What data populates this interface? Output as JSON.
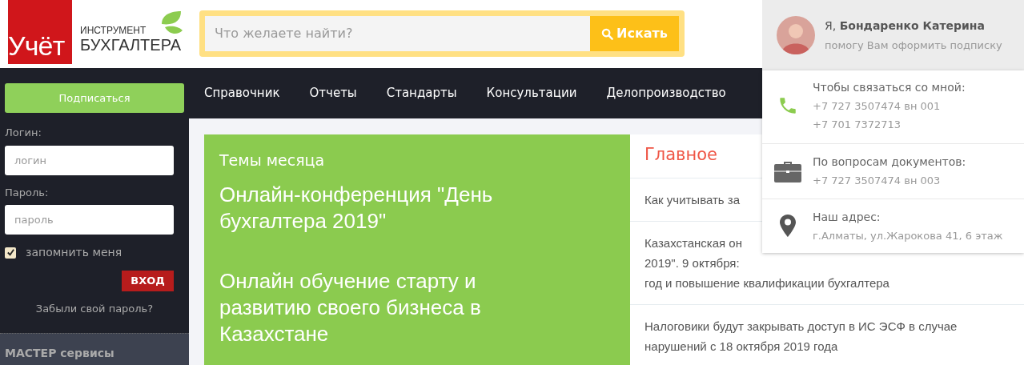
{
  "logo": {
    "mark": "Учёт",
    "line_1": "ИНСТРУМЕНТ",
    "line_2": "БУХГАЛТЕРА"
  },
  "search": {
    "placeholder": "Что желаете найти?",
    "button": "Искать"
  },
  "consultant": {
    "name": "Я, **Бондаренко Катерина**",
    "subtitle": "помогу Вам оформить подписку"
  },
  "contact_popup": [
    {
      "kind": "phone",
      "title": "Чтобы связаться со мной:",
      "lines": [
        "+7 727 3507474 вн 001",
        "+7 701 7372713"
      ]
    },
    {
      "kind": "briefcase",
      "title": "По вопросам документов:",
      "lines": [
        "+7 727 3507474 вн 003"
      ]
    },
    {
      "kind": "location",
      "title": "Наш адрес:",
      "lines": [
        "г.Алматы, ул.Жарокова 41, 6 этаж"
      ]
    }
  ],
  "sidebar": {
    "subscribe_button": "Подписаться",
    "login_label": "Логин:",
    "login_placeholder": "логин",
    "password_label": "Пароль:",
    "password_placeholder": "пароль",
    "remember": {
      "label": "запомнить меня",
      "checked": true
    },
    "login_button": "ВХОД",
    "forgot_link": "Забыли свой пароль?",
    "section_title": "МАСТЕР сервисы"
  },
  "nav": [
    "Справочник",
    "Отчеты",
    "Стандарты",
    "Консультации",
    "Делопроизводство"
  ],
  "month_topics": {
    "title": "Темы месяца",
    "headlines": [
      "Онлайн-конференция \"День бухгалтера 2019\"",
      "Онлайн обучение старту и развитию своего бизнеса в Казахстане"
    ]
  },
  "main_news": {
    "title": "Главное",
    "items": [
      {
        "lines": [
          "Как учитывать за"
        ]
      },
      {
        "lines": [
          "Казахстанская он",
          "2019\". 9 октября:",
          "год и повышение квалификации бухгалтера"
        ]
      },
      {
        "lines": [
          "Налоговики будут закрывать доступ в ИС ЭСФ в случае нарушений с 18 октября 2019 года"
        ]
      }
    ]
  }
}
